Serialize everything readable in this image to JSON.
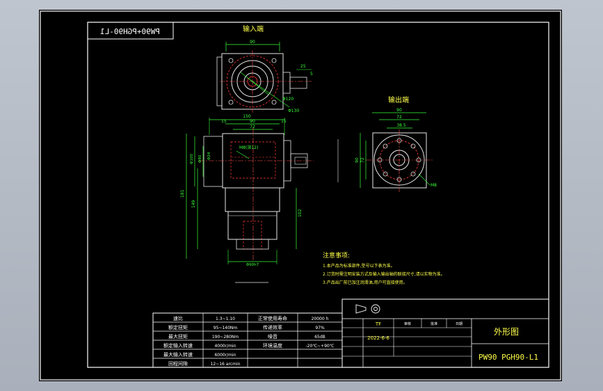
{
  "colors": {
    "frame": "#ffffff",
    "outline": "#e8e8e8",
    "hidden": "#ff3b3b",
    "center_line": "#ff5050",
    "dimension": "#39ff39",
    "note": "#ffff4a",
    "table_text": "#ffffff"
  },
  "part_code_mirrored": "PW90+PGH90-L1",
  "views": {
    "input_label": "输入端",
    "output_label": "输出端"
  },
  "top_view_dims": {
    "width": "90",
    "key": "25",
    "key_small": "5",
    "dia1": "Φ120",
    "dia2": "Φ130"
  },
  "front_view_dims": {
    "overall": "150",
    "mid": "90",
    "inner": "72",
    "left_offset": "15",
    "right_offset": "15",
    "hole": "M8(深12)",
    "height_total": "181",
    "height_lower": "149",
    "height_right": "102",
    "bore": "Φ24",
    "pilot": "Φ80",
    "flange": "Φ100",
    "bottom_dia": "Φ90h7"
  },
  "side_view_dims": {
    "width": "90",
    "inner": "72",
    "pitch": "38.5",
    "side_h1": "90",
    "side_h2": "72",
    "holes": "M8"
  },
  "notes": {
    "title": "注意事项:",
    "items": [
      "1.本产品为标准部件,型号以下表为准。",
      "2.订货时需注明安装方式及输入输出轴的联接尺寸,请以实物为准。",
      "3.产品出厂前已加注润滑油,用户可直接使用。"
    ]
  },
  "spec_table": [
    {
      "label": "速比",
      "value": "1.3~1.10",
      "label2": "正常使用寿命",
      "value2": "20000 h"
    },
    {
      "label": "额定扭矩",
      "value": "95~140Nm",
      "label2": "传递效率",
      "value2": "97%"
    },
    {
      "label": "最大扭矩",
      "value": "190~280Nm",
      "label2": "噪音",
      "value2": "65dB"
    },
    {
      "label": "额定输入转速",
      "value": "4000r/min",
      "label2": "环境温度",
      "value2": "-20℃~+90℃"
    },
    {
      "label": "最大输入转速",
      "value": "6000r/min",
      "label2": "",
      "value2": ""
    },
    {
      "label": "回程间隙",
      "value": "12~16 arcmin",
      "label2": "",
      "value2": ""
    }
  ],
  "title_block": {
    "drawer": "TF",
    "date": "2022-6-6",
    "col_a": "审核",
    "col_b": "批准",
    "col_c": "日期",
    "drawing_name": "外形图",
    "model": "PW90 PGH90-L1"
  }
}
